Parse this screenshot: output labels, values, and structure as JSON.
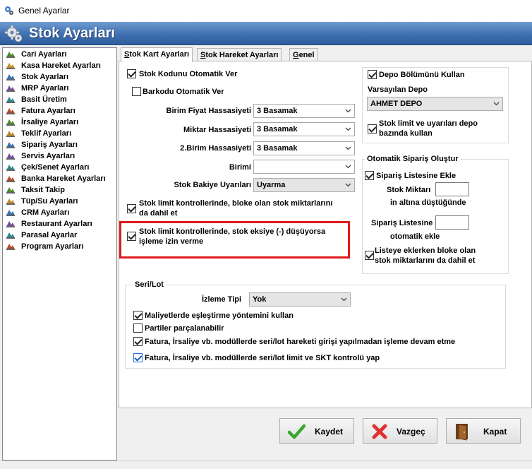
{
  "window": {
    "title": "Genel Ayarlar"
  },
  "banner": {
    "title": "Stok Ayarları"
  },
  "sidebar": {
    "items": [
      {
        "label": "Cari Ayarları"
      },
      {
        "label": "Kasa Hareket Ayarları"
      },
      {
        "label": "Stok Ayarları"
      },
      {
        "label": "MRP Ayarları"
      },
      {
        "label": "Basit Üretim"
      },
      {
        "label": "Fatura Ayarları"
      },
      {
        "label": "İrsaliye Ayarları"
      },
      {
        "label": "Teklif Ayarları"
      },
      {
        "label": "Sipariş Ayarları"
      },
      {
        "label": "Servis Ayarları"
      },
      {
        "label": "Çek/Senet Ayarları"
      },
      {
        "label": "Banka Hareket Ayarları"
      },
      {
        "label": "Taksit Takip"
      },
      {
        "label": "Tüp/Su Ayarları"
      },
      {
        "label": "CRM Ayarları"
      },
      {
        "label": "Restaurant Ayarları"
      },
      {
        "label": "Parasal Ayarlar"
      },
      {
        "label": "Program Ayarları"
      }
    ]
  },
  "tabs": [
    {
      "u": "S",
      "rest": "tok Kart Ayarları"
    },
    {
      "u": "S",
      "rest": "tok Hareket Ayarları"
    },
    {
      "u": "G",
      "rest": "enel"
    }
  ],
  "stock": {
    "auto_code": {
      "label": "Stok Kodunu Otomatik Ver",
      "checked": true
    },
    "auto_barcode": {
      "label": "Barkodu Otomatik Ver",
      "checked": false
    },
    "unit_price_precision": {
      "label": "Birim Fiyat Hassasiyeti",
      "value": "3 Basamak"
    },
    "quantity_precision": {
      "label": "Miktar Hassasiyeti",
      "value": "3 Basamak"
    },
    "unit2_precision": {
      "label": "2.Birim Hassasiyeti",
      "value": "3 Basamak"
    },
    "unit": {
      "label": "Birimi",
      "value": ""
    },
    "balance_warning": {
      "label": "Stok Bakiye Uyarıları",
      "value": "Uyarma"
    },
    "limit_blocked": {
      "line1": "Stok limit kontrollerinde, bloke olan stok miktarlarını",
      "line2": "da dahil et",
      "checked": true
    },
    "limit_negative": {
      "line1": "Stok limit kontrollerinde, stok eksiye (-) düşüyorsa",
      "line2": "işleme izin verme",
      "checked": true
    }
  },
  "depot": {
    "use_depot": {
      "label": "Depo Bölümünü Kullan",
      "checked": true
    },
    "default_label": "Varsayılan Depo",
    "default_value": "AHMET DEPO",
    "depot_based": {
      "line1": "Stok limit ve uyarıları depo",
      "line2": "bazında kullan",
      "checked": true
    }
  },
  "auto_order": {
    "title": "Otomatik Sipariş Oluştur",
    "add_to_list": {
      "label": "Sipariş Listesine Ekle",
      "checked": true
    },
    "stock_qty_label1": "Stok Miktarı",
    "stock_qty_label2": "in altına düştüğünde",
    "order_list_label1": "Sipariş Listesine",
    "order_list_label2": "otomatik ekle",
    "include_blocked": {
      "line1": "Listeye eklerken bloke olan",
      "line2": "stok miktarlarını da dahil et",
      "checked": true
    }
  },
  "serial": {
    "title": "Seri/Lot",
    "tracking_label": "İzleme Tipi",
    "tracking_value": "Yok",
    "cost_matching": {
      "label": "Maliyetlerde eşleştirme yöntemini kullan",
      "checked": true
    },
    "split_batches": {
      "label": "Partiler parçalanabilir",
      "checked": false
    },
    "continue_without": {
      "label": "Fatura, İrsaliye vb. modüllerde seri/lot hareketi girişi yapılmadan işleme devam etme",
      "checked": true
    },
    "limit_skt": {
      "label": "Fatura, İrsaliye vb. modüllerde seri/lot limit ve SKT kontrolü yap",
      "checked": true
    }
  },
  "buttons": {
    "save": "Kaydet",
    "cancel": "Vazgeç",
    "close": "Kapat"
  },
  "colors": {
    "highlight_border": "#e01a1a",
    "banner": "#3e6fb0"
  }
}
